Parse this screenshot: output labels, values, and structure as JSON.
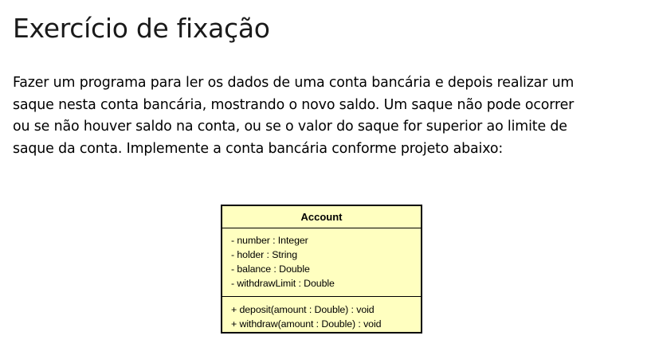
{
  "slide": {
    "title": "Exercício de fixação",
    "paragraph_lines": [
      "Fazer um programa para ler os dados de uma conta bancária e depois realizar um",
      "saque nesta conta bancária, mostrando o novo saldo. Um saque não pode ocorrer",
      "ou se não houver saldo na conta, ou se o valor do saque for superior ao limite de",
      "saque da conta. Implemente a conta bancária conforme projeto abaixo:"
    ]
  },
  "uml_class": {
    "name": "Account",
    "attributes": [
      "- number : Integer",
      "- holder : String",
      "- balance : Double",
      "- withdrawLimit : Double"
    ],
    "operations": [
      "+ deposit(amount : Double) : void",
      "+ withdraw(amount : Double) : void"
    ],
    "colors": {
      "fill": "#ffffc0",
      "border": "#000000"
    }
  }
}
